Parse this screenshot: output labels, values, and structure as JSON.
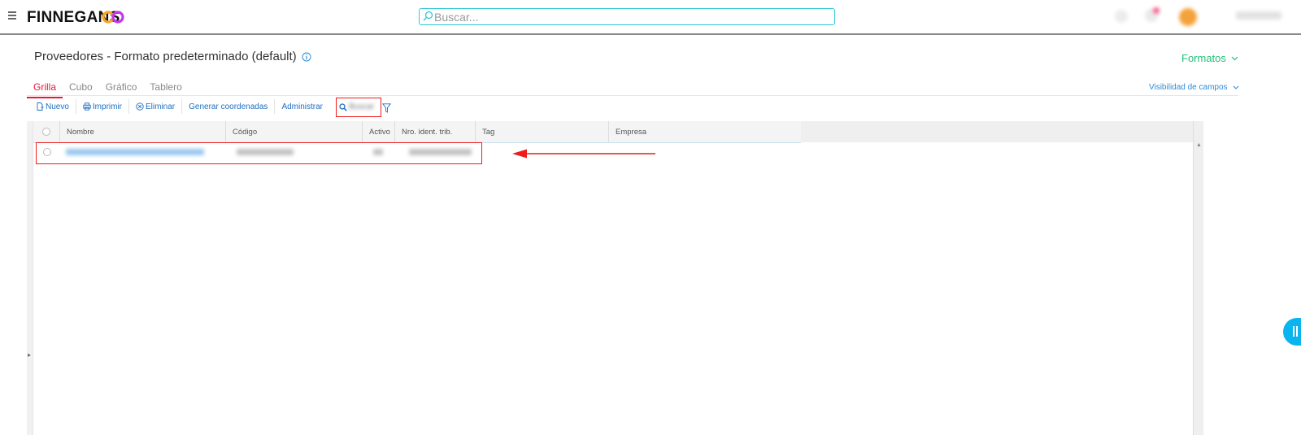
{
  "app": {
    "logo": "FINNEGANS",
    "search_placeholder": "Buscar..."
  },
  "header": {
    "title": "Proveedores - Formato predeterminado (default)",
    "formatos_label": "Formatos",
    "visibilidad_label": "Visibilidad de campos"
  },
  "tabs": [
    {
      "label": "Grilla",
      "active": true
    },
    {
      "label": "Cubo",
      "active": false
    },
    {
      "label": "Gráfico",
      "active": false
    },
    {
      "label": "Tablero",
      "active": false
    }
  ],
  "toolbar": {
    "nuevo": "Nuevo",
    "imprimir": "Imprimir",
    "eliminar": "Eliminar",
    "generar": "Generar coordenadas",
    "administrar": "Administrar",
    "buscar": "Buscar"
  },
  "grid": {
    "columns": [
      "Nombre",
      "Código",
      "Activo",
      "Nro. ident. trib.",
      "Tag",
      "Empresa"
    ]
  },
  "colors": {
    "accent_red": "#e8173a",
    "link_blue": "#1f6fc1",
    "formatos_green": "#22c07a",
    "search_border": "#35c8d8",
    "highlight_red": "#ee1c1c"
  }
}
